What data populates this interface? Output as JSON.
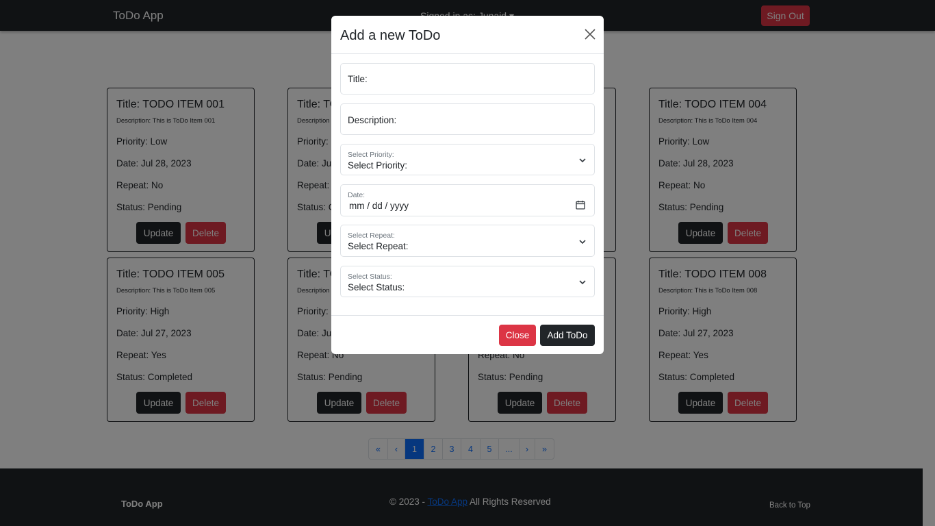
{
  "navbar": {
    "brand": "ToDo App",
    "signed_in": "Signed in as: Junaid ▾",
    "sign_out": "Sign Out"
  },
  "cards": [
    {
      "title": "Title: TODO ITEM 001",
      "description": "Description: This is ToDo Item 001",
      "priority": "Priority: Low",
      "date": "Date: Jul 28, 2023",
      "repeat": "Repeat: No",
      "status": "Status: Pending"
    },
    {
      "title": "Title: TO",
      "description": "Description",
      "priority": "Priority: L",
      "date": "Date: Jul",
      "repeat": "Repeat: Y",
      "status": "Status: C"
    },
    {
      "title": "Title: TODO ITEM 004",
      "description": "Description: This is ToDo Item 004",
      "priority": "Priority: Low",
      "date": "Date: Jul 28, 2023",
      "repeat": "Repeat: No",
      "status": "Status: Pending"
    },
    {
      "title": "Title: TODO ITEM 005",
      "description": "Description: This is ToDo Item 005",
      "priority": "Priority: High",
      "date": "Date: Jul 27, 2023",
      "repeat": "Repeat: Yes",
      "status": "Status: Completed"
    },
    {
      "title": "Title: TO",
      "description": "Description",
      "priority": "Priority: I",
      "date": "Date: Jul",
      "repeat": "Repeat: No",
      "status": "Status: Pending"
    },
    {
      "repeat": "Repeat: No",
      "status": "Status: Pending"
    },
    {
      "title": "Title: TODO ITEM 008",
      "description": "Description: This is ToDo Item 008",
      "priority": "Priority: High",
      "date": "Date: Jul 27, 2023",
      "repeat": "Repeat: Yes",
      "status": "Status: Completed"
    }
  ],
  "buttons": {
    "update": "Update",
    "delete": "Delete"
  },
  "pagination": [
    "«",
    "‹",
    "1",
    "2",
    "3",
    "4",
    "5",
    "...",
    "›",
    "»"
  ],
  "footer": {
    "brand": "ToDo App",
    "copy_prefix": "© 2023 - ",
    "copy_link": "ToDo App",
    "copy_suffix": " All Rights Reserved",
    "back_to_top": "Back to Top"
  },
  "modal": {
    "title": "Add a new ToDo",
    "title_field": "Title:",
    "description_field": "Description:",
    "priority": {
      "label": "Select Priority:",
      "value": "Select Priority:"
    },
    "date": {
      "label": "Date:",
      "value": "mm / dd / yyyy"
    },
    "repeat": {
      "label": "Select Repeat:",
      "value": "Select Repeat:"
    },
    "status": {
      "label": "Select Status:",
      "value": "Select Status:"
    },
    "close": "Close",
    "add": "Add ToDo"
  }
}
